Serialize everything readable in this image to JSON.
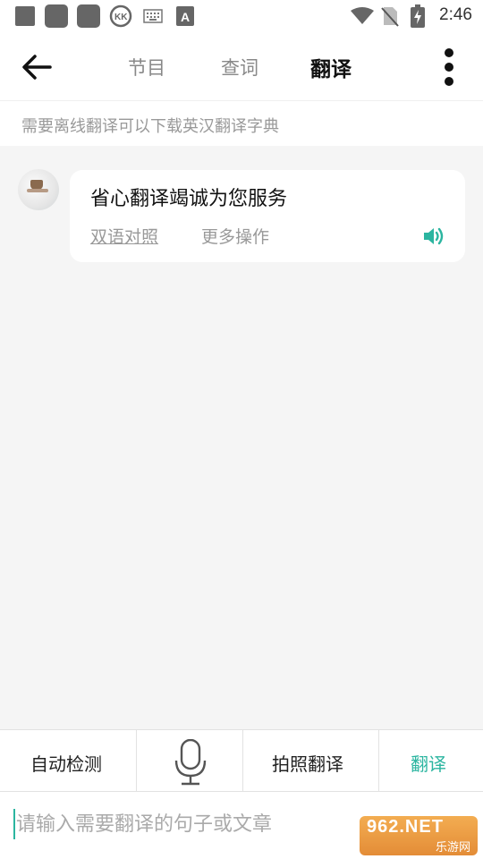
{
  "status_bar": {
    "time": "2:46",
    "icons": [
      "notification-square-icon",
      "notification-square-icon",
      "notification-square-icon",
      "kk-app-icon",
      "keyboard-icon",
      "font-a-icon",
      "wifi-icon",
      "no-sim-icon",
      "battery-charging-icon"
    ]
  },
  "header": {
    "tabs": [
      {
        "label": "节目",
        "active": false
      },
      {
        "label": "查词",
        "active": false
      },
      {
        "label": "翻译",
        "active": true
      }
    ],
    "icons": {
      "back": "arrow-left-icon",
      "more": "more-vertical-icon"
    }
  },
  "notice": "需要离线翻译可以下载英汉翻译字典",
  "chat": {
    "messages": [
      {
        "text": "省心翻译竭诚为您服务",
        "actions": [
          "双语对照",
          "更多操作"
        ],
        "icon": "speaker-icon"
      }
    ]
  },
  "toolbar": {
    "detect_label": "自动检测",
    "mic_icon": "microphone-icon",
    "photo_label": "拍照翻译",
    "translate_label": "翻译"
  },
  "input": {
    "placeholder": "请输入需要翻译的句子或文章",
    "value": ""
  },
  "watermark": {
    "top": "962.NET",
    "bottom": "乐游网"
  },
  "colors": {
    "accent": "#2bb5a0",
    "background": "#f5f5f5",
    "muted_text": "#999999"
  }
}
